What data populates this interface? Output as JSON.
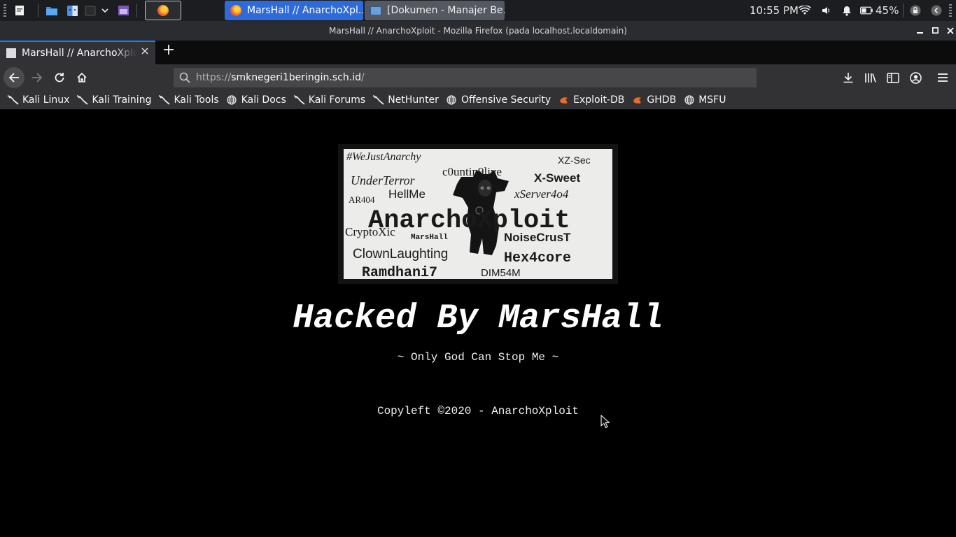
{
  "taskbar": {
    "tasks": [
      {
        "title": "MarsHall // AnarchoXpl...",
        "active": true
      },
      {
        "title": "[Dokumen - Manajer Be...",
        "active": false
      }
    ],
    "clock": "10:55 PM",
    "battery": "45%",
    "icons": [
      "grip-handle-icon",
      "text-editor-icon",
      "file-manager-icon",
      "finder-icon",
      "terminal-icon",
      "chevron-down-icon",
      "screenshot-tool-icon",
      "firefox-icon",
      "wifi-icon",
      "volume-icon",
      "bell-icon",
      "battery-icon",
      "lock-icon",
      "back-arrow-icon"
    ]
  },
  "window": {
    "title": "MarsHall // AnarchoXploit - Mozilla Firefox (pada localhost.localdomain)"
  },
  "tabs": [
    {
      "title": "MarsHall // AnarchoXploit"
    }
  ],
  "urlbar": {
    "protocol": "https://",
    "host": "smknegeri1beringin.sch.id",
    "path": "/"
  },
  "bookmarks": [
    {
      "label": "Kali Linux",
      "icon": "kali-dragon-icon"
    },
    {
      "label": "Kali Training",
      "icon": "kali-dragon-icon"
    },
    {
      "label": "Kali Tools",
      "icon": "kali-dragon-icon"
    },
    {
      "label": "Kali Docs",
      "icon": "globe-icon"
    },
    {
      "label": "Kali Forums",
      "icon": "kali-dragon-icon"
    },
    {
      "label": "NetHunter",
      "icon": "kali-dragon-icon"
    },
    {
      "label": "Offensive Security",
      "icon": "globe-icon"
    },
    {
      "label": "Exploit-DB",
      "icon": "exploit-db-icon"
    },
    {
      "label": "GHDB",
      "icon": "exploit-db-icon"
    },
    {
      "label": "MSFU",
      "icon": "globe-icon"
    }
  ],
  "page": {
    "logo_words": [
      "#WeJustAnarchy",
      "XZ-Sec",
      "c0untin9live",
      "X-Sweet",
      "UnderTerror",
      "xServer4o4",
      "HellMe",
      "AR404",
      "AnarchoXploit",
      "CryptoXic",
      "MarsHall",
      "NoiseCrusT",
      "ClownLaughting",
      "Hex4core",
      "Ramdhani7",
      "DIM54M"
    ],
    "heading": "Hacked By MarsHall",
    "tagline": "~ Only God Can Stop Me ~",
    "copyleft": "Copyleft ©2020 - AnarchoXploit"
  },
  "colors": {
    "active_task": "#2f6bd8",
    "tab_accent": "#0a84ff",
    "page_background": "#000000",
    "exploit_db_orange": "#ec6a2b"
  }
}
